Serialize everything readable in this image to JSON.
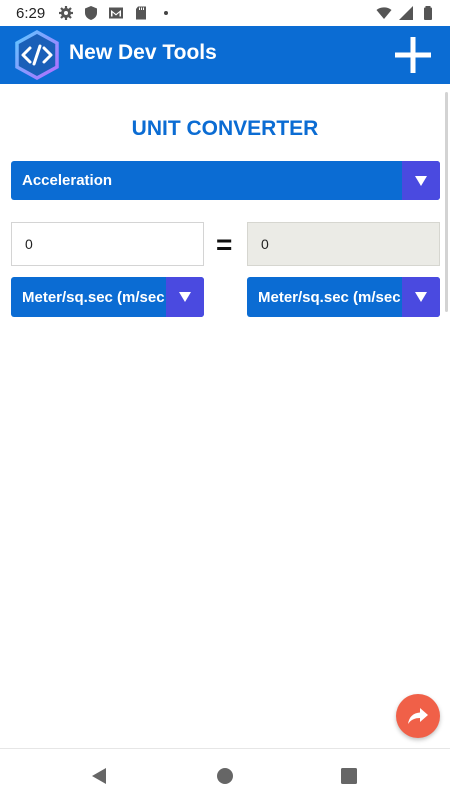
{
  "status_bar": {
    "time": "6:29",
    "left_icons": [
      "settings-icon",
      "shield-icon",
      "gmail-icon",
      "sd-card-icon",
      "dot-icon"
    ],
    "right_icons": [
      "wifi-icon",
      "cellular-icon",
      "battery-icon"
    ]
  },
  "app_bar": {
    "title": "New Dev Tools",
    "logo_icon": "code-hexagon-logo",
    "action_icon": "plus-icon",
    "background": "#0b6cd3"
  },
  "converter": {
    "title": "UNIT CONVERTER",
    "category": "Acceleration",
    "from_value": "0",
    "to_value": "0",
    "equals": "=",
    "from_unit": "Meter/sq.sec (m/sec",
    "to_unit": "Meter/sq.sec (m/sec",
    "arrow": "▼"
  },
  "fab": {
    "icon": "share-icon",
    "color": "#f06048"
  },
  "nav_bar": {
    "icons": [
      "back-icon",
      "home-icon",
      "recents-icon"
    ]
  },
  "colors": {
    "accent": "#0b6cd3",
    "dropdown_button": "#4a4ae0",
    "readonly_field": "#ebebe6"
  }
}
